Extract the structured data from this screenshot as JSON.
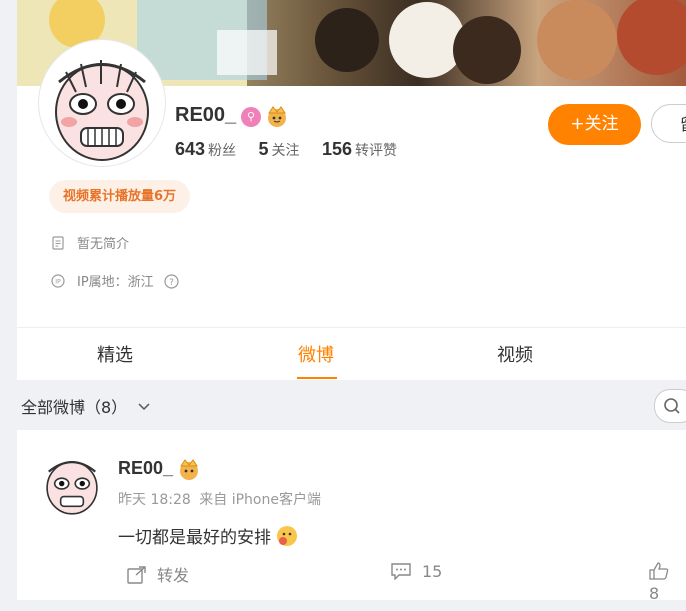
{
  "profile": {
    "username": "RE00_",
    "badge_symbol": "⚲",
    "stats": [
      {
        "value": "643",
        "label": "粉丝"
      },
      {
        "value": "5",
        "label": "关注"
      },
      {
        "value": "156",
        "label": "转评赞"
      }
    ],
    "follow_label": "+关注",
    "more_label": "留",
    "video_tag": "视频累计播放量6万",
    "bio": "暂无简介",
    "ip_location": "IP属地：浙江"
  },
  "tabs": [
    {
      "label": "精选"
    },
    {
      "label": "微博"
    },
    {
      "label": "视频"
    }
  ],
  "active_tab": "微博",
  "filter": {
    "label": "全部微博（8）"
  },
  "post": {
    "username": "RE00_",
    "time": "昨天 18:28",
    "source": "来自 iPhone客户端",
    "text": "一切都是最好的安排",
    "actions": {
      "repost_label": "转发",
      "comment_count": "15",
      "like_count": "8"
    }
  },
  "colors": {
    "accent": "#ff8200",
    "tag_bg": "#fdf0e6",
    "tag_text": "#e8742a",
    "badge_pink": "#f081b8"
  }
}
